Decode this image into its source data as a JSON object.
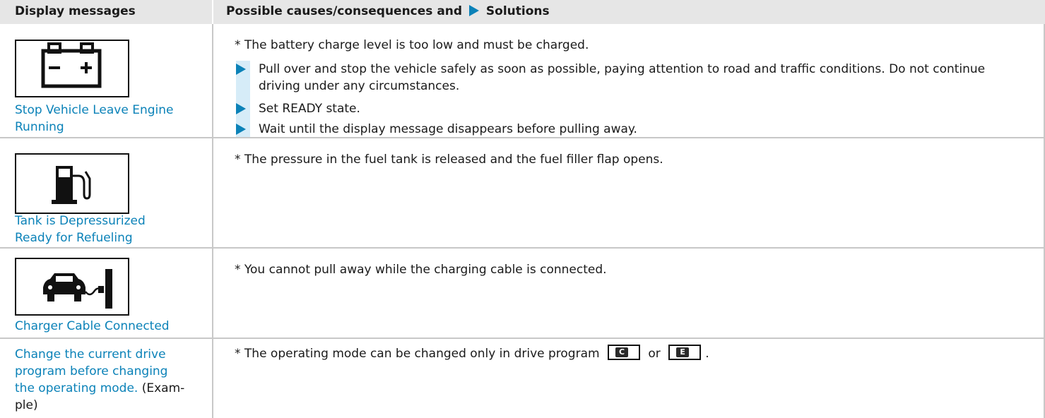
{
  "header": {
    "col1": "Display messages",
    "col2_prefix": "Possible causes/consequences and",
    "col2_suffix": "Solutions"
  },
  "rows": [
    {
      "display": "Stop Vehicle Leave Engine Running",
      "icon": "battery-icon",
      "cause": "* The battery charge level is too low and must be charged.",
      "steps": [
        "Pull over and stop the vehicle safely as soon as possible, paying attention to road and traffic conditions. Do not continue driving under any circumstances.",
        "Set READY state.",
        "Wait until the display message disappears before pulling away."
      ]
    },
    {
      "display_line1": "Tank is Depressurized",
      "display_line2": "Ready for Refueling",
      "icon": "fuel-pump-icon",
      "cause": "* The pressure in the fuel tank is released and the fuel filler flap opens."
    },
    {
      "display": "Charger Cable Connected",
      "icon": "car-charging-cable-icon",
      "cause": "* You cannot pull away while the charging cable is connected."
    },
    {
      "display_line1": "Change the current drive",
      "display_line2": "program before changing",
      "display_line3a": "the operating mode.",
      "display_line3b": "(Exam-",
      "display_line4": "ple)",
      "cause_prefix": "* The operating mode can be changed only in drive program",
      "key1": "C",
      "cause_mid": "or",
      "key2": "E",
      "cause_suffix": "."
    }
  ],
  "colors": {
    "accent": "#0b82b8",
    "header_bg": "#e6e6e6",
    "step_bar": "#d6ecf8"
  }
}
